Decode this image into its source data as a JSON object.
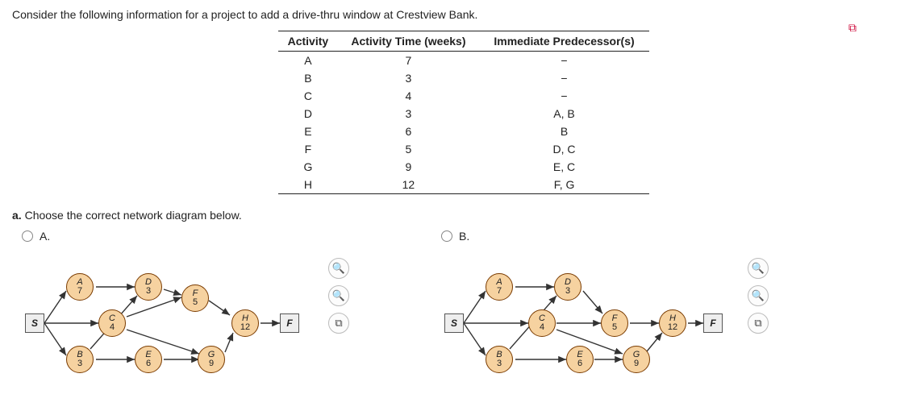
{
  "intro": "Consider the following information for a project to add a drive-thru window at Crestview Bank.",
  "table": {
    "headers": [
      "Activity",
      "Activity Time (weeks)",
      "Immediate Predecessor(s)"
    ],
    "rows": [
      {
        "activity": "A",
        "time": "7",
        "pred": "−"
      },
      {
        "activity": "B",
        "time": "3",
        "pred": "−"
      },
      {
        "activity": "C",
        "time": "4",
        "pred": "−"
      },
      {
        "activity": "D",
        "time": "3",
        "pred": "A, B"
      },
      {
        "activity": "E",
        "time": "6",
        "pred": "B"
      },
      {
        "activity": "F",
        "time": "5",
        "pred": "D, C"
      },
      {
        "activity": "G",
        "time": "9",
        "pred": "E, C"
      },
      {
        "activity": "H",
        "time": "12",
        "pred": "F, G"
      }
    ]
  },
  "partA": {
    "prefix": "a.",
    "text": "Choose the correct network diagram below."
  },
  "options": {
    "A": {
      "label": "A."
    },
    "B": {
      "label": "B."
    }
  },
  "nodes": {
    "S": "S",
    "F": "F",
    "A": {
      "name": "A",
      "time": "7"
    },
    "B": {
      "name": "B",
      "time": "3"
    },
    "C": {
      "name": "C",
      "time": "4"
    },
    "D": {
      "name": "D",
      "time": "3"
    },
    "E": {
      "name": "E",
      "time": "6"
    },
    "Fn": {
      "name": "F",
      "time": "5"
    },
    "G": {
      "name": "G",
      "time": "9"
    },
    "H": {
      "name": "H",
      "time": "12"
    }
  },
  "icons": {
    "zoomin": "🔍",
    "zoomout": "🔍",
    "open": "⧉",
    "popup": "⧉"
  }
}
